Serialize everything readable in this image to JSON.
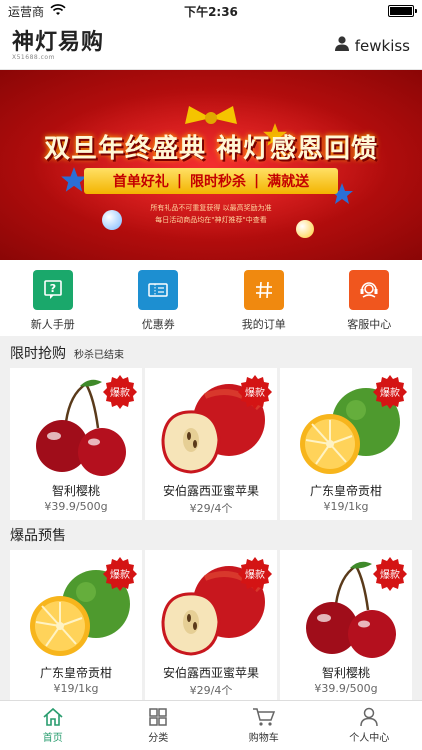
{
  "status_bar": {
    "carrier": "运营商",
    "time": "下午2:36"
  },
  "header": {
    "logo_text": "神灯易购",
    "logo_sub": "X51688.com",
    "username": "fewkiss"
  },
  "banner": {
    "title": "双旦年终盛典 神灯感恩回馈",
    "tags": [
      "首单好礼",
      "限时秒杀",
      "满就送"
    ],
    "fine_print_1": "所有礼品不可重复获得 以最高奖励为准",
    "fine_print_2": "每日活动商品均在\"神灯推荐\"中查看"
  },
  "quick_nav": [
    {
      "label": "新人手册",
      "icon": "question-icon",
      "color": "#1aa86b"
    },
    {
      "label": "优惠券",
      "icon": "coupon-icon",
      "color": "#1d8fd1"
    },
    {
      "label": "我的订单",
      "icon": "hash-icon",
      "color": "#f0890f"
    },
    {
      "label": "客服中心",
      "icon": "headset-icon",
      "color": "#f0561e"
    }
  ],
  "flash_sale": {
    "title": "限时抢购",
    "subtitle": "秒杀已结束",
    "items": [
      {
        "name": "智利樱桃",
        "price": "¥39.9/500g",
        "badge": "爆款",
        "fruit": "cherry"
      },
      {
        "name": "安伯露西亚蜜苹果",
        "price": "¥29/4个",
        "badge": "爆款",
        "fruit": "apple"
      },
      {
        "name": "广东皇帝贡柑",
        "price": "¥19/1kg",
        "badge": "爆款",
        "fruit": "orange"
      }
    ]
  },
  "presale": {
    "title": "爆品预售",
    "items": [
      {
        "name": "广东皇帝贡柑",
        "price": "¥19/1kg",
        "badge": "爆款",
        "fruit": "orange"
      },
      {
        "name": "安伯露西亚蜜苹果",
        "price": "¥29/4个",
        "badge": "爆款",
        "fruit": "apple"
      },
      {
        "name": "智利樱桃",
        "price": "¥39.9/500g",
        "badge": "爆款",
        "fruit": "cherry"
      }
    ]
  },
  "tab_bar": [
    {
      "label": "首页",
      "icon": "home-icon",
      "active": true
    },
    {
      "label": "分类",
      "icon": "grid-icon",
      "active": false
    },
    {
      "label": "购物车",
      "icon": "cart-icon",
      "active": false
    },
    {
      "label": "个人中心",
      "icon": "person-icon",
      "active": false
    }
  ],
  "colors": {
    "brand_red": "#c40f0f",
    "badge_red": "#d41414",
    "active_tab": "#2a9d6f"
  }
}
